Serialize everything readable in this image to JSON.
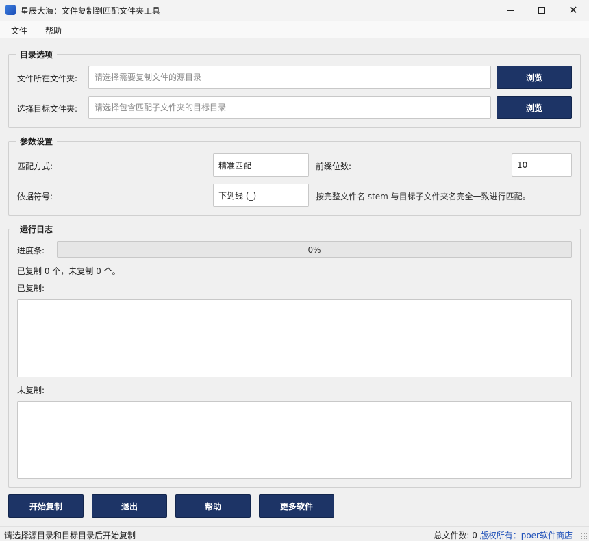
{
  "window": {
    "title": "星辰大海：文件复制到匹配文件夹工具",
    "controls": {
      "minimize": "minimize-icon",
      "maximize": "maximize-icon",
      "close": "close-icon"
    }
  },
  "menu": {
    "file": "文件",
    "help": "帮助"
  },
  "directory_group": {
    "title": "目录选项",
    "source_label": "文件所在文件夹:",
    "source_placeholder": "请选择需要复制文件的源目录",
    "source_value": "",
    "target_label": "选择目标文件夹:",
    "target_placeholder": "请选择包含匹配子文件夹的目标目录",
    "target_value": "",
    "browse_label": "浏览"
  },
  "params_group": {
    "title": "参数设置",
    "match_label": "匹配方式:",
    "match_value": "精准匹配",
    "prefix_label": "前缀位数:",
    "prefix_value": "10",
    "delimiter_label": "依据符号:",
    "delimiter_value": "下划线 (_)",
    "hint": "按完整文件名 stem 与目标子文件夹名完全一致进行匹配。"
  },
  "log_group": {
    "title": "运行日志",
    "progress_label": "进度条:",
    "progress_percent": 0,
    "progress_text": "0%",
    "summary": "已复制 0 个，未复制 0 个。",
    "copied_label": "已复制:",
    "not_copied_label": "未复制:"
  },
  "actions": {
    "start": "开始复制",
    "exit": "退出",
    "help": "帮助",
    "more": "更多软件"
  },
  "status": {
    "message": "请选择源目录和目标目录后开始复制",
    "total_files": "总文件数:  0",
    "copyright": "版权所有：poer软件商店"
  },
  "colors": {
    "button_bg": "#1d3466",
    "link": "#1d4fb8",
    "accent_icon": "#2f6fd6"
  }
}
